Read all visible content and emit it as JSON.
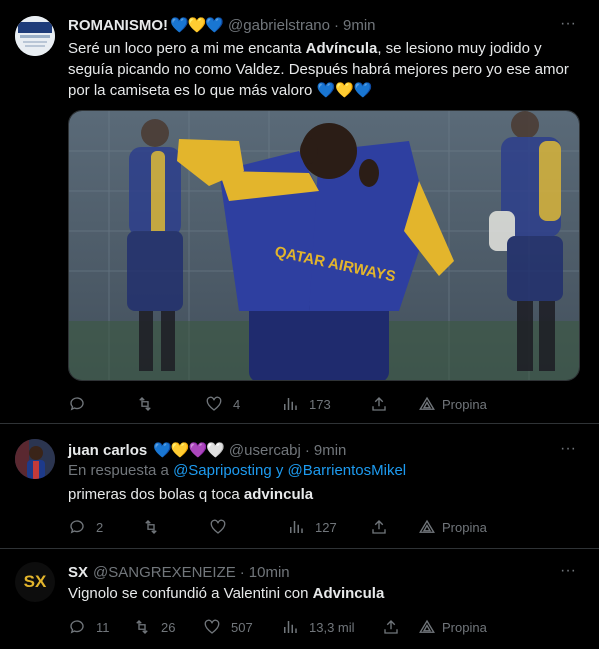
{
  "tweets": [
    {
      "name": "ROMANISMO!",
      "emoji": "💙💛💙",
      "handle": "@gabrielstrano",
      "dot": "·",
      "time": "9min",
      "text_a": "Seré un loco pero a mi me encanta ",
      "text_bold": "Advíncula",
      "text_b": ", se lesiono muy jodido y seguía picando no como Valdez. Después habrá mejores pero yo ese amor por la camiseta es lo que más valoro ",
      "text_emoji": "💙💛💙",
      "image_text": "QATAR AIRWAYS",
      "replies": "",
      "retweets": "",
      "likes": "4",
      "views": "173",
      "promo": "Propina"
    },
    {
      "name": "juan carlos",
      "emoji": "💙💛💜🤍",
      "handle": "@usercabj",
      "dot": "·",
      "time": "9min",
      "reply_prefix": "En respuesta a ",
      "reply_user1": "@Sapriposting",
      "reply_and": " y ",
      "reply_user2": "@BarrientosMikel",
      "text_a": "primeras dos bolas q toca ",
      "text_bold": "advincula",
      "replies": "2",
      "retweets": "",
      "likes": "",
      "views": "127",
      "promo": "Propina"
    },
    {
      "name": "SX",
      "avatar_text": "SX",
      "handle": "@SANGREXENEIZE",
      "dot": "·",
      "time": "10min",
      "text_a": "Vignolo se confundió a Valentini con ",
      "text_bold": "Advincula",
      "replies": "11",
      "retweets": "26",
      "likes": "507",
      "views": "13,3 mil",
      "promo": "Propina"
    }
  ],
  "more_label": "···",
  "colors": {
    "accent": "#1d9bf0",
    "muted": "#71767b",
    "text": "#e7e9ea",
    "border": "#2f3336"
  }
}
